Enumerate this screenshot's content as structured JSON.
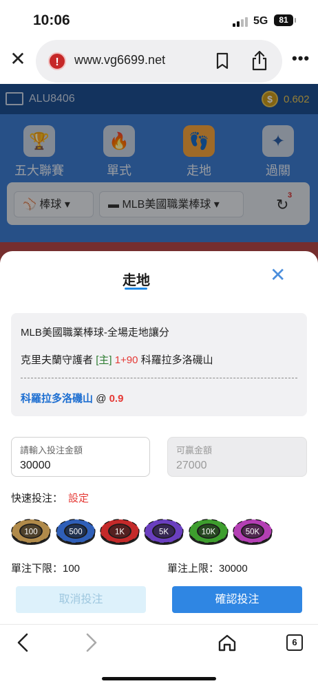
{
  "status_bar": {
    "time": "10:06",
    "network": "5G",
    "battery": "81"
  },
  "browser": {
    "url": "www.vg6699.net",
    "tab_count": "6"
  },
  "account": {
    "username": "ALU8406",
    "balance": "0.602"
  },
  "categories": [
    {
      "label": "五大聯賽",
      "icon": "trophy-icon"
    },
    {
      "label": "單式",
      "icon": "flame-icon"
    },
    {
      "label": "走地",
      "icon": "footprint-icon",
      "active": true
    },
    {
      "label": "過關",
      "icon": "sparkle-icon"
    }
  ],
  "filters": {
    "sport": "棒球",
    "league": "MLB美國職業棒球",
    "refresh_count": "3"
  },
  "sheet": {
    "title": "走地",
    "league_line": "MLB美國職業棒球-全場走地讓分",
    "match": {
      "home_team": "克里夫蘭守護者",
      "home_tag": "[主]",
      "handicap": "1+90",
      "away_team": "科羅拉多洛磯山"
    },
    "pick": {
      "team": "科羅拉多洛磯山",
      "at": "@",
      "odds": "0.9"
    },
    "bet_amount": {
      "placeholder": "請輸入投注金額",
      "value": "30000"
    },
    "win_amount": {
      "placeholder": "可贏金額",
      "value": "27000"
    },
    "quick_bet_label": "快速投注：",
    "quick_bet_settings": "設定",
    "chips": [
      {
        "label": "100",
        "color": "#b08a4a"
      },
      {
        "label": "500",
        "color": "#2f5fb8"
      },
      {
        "label": "1K",
        "color": "#c42a2a"
      },
      {
        "label": "5K",
        "color": "#6a3fbf"
      },
      {
        "label": "10K",
        "color": "#3e9e2e"
      },
      {
        "label": "50K",
        "color": "#b43fb4"
      }
    ],
    "min_limit": "單注下限：100",
    "max_limit": "單注上限：30000",
    "cancel_label": "取消投注",
    "confirm_label": "確認投注"
  }
}
